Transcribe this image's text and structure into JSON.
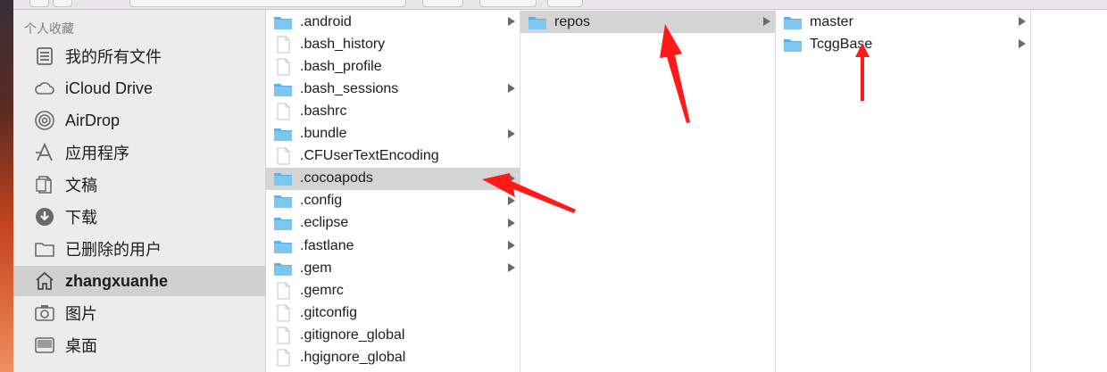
{
  "sidebar": {
    "header": "个人收藏",
    "items": [
      {
        "label": "我的所有文件",
        "icon": "all-files-icon"
      },
      {
        "label": "iCloud Drive",
        "icon": "cloud-icon"
      },
      {
        "label": "AirDrop",
        "icon": "airdrop-icon"
      },
      {
        "label": "应用程序",
        "icon": "applications-icon"
      },
      {
        "label": "文稿",
        "icon": "documents-icon"
      },
      {
        "label": "下载",
        "icon": "downloads-icon"
      },
      {
        "label": "已删除的用户",
        "icon": "folder-icon"
      },
      {
        "label": "zhangxuanhe",
        "icon": "home-icon",
        "selected": true
      },
      {
        "label": "图片",
        "icon": "pictures-icon"
      },
      {
        "label": "桌面",
        "icon": "desktop-icon"
      }
    ]
  },
  "column1": {
    "items": [
      {
        "name": ".android",
        "type": "folder",
        "expandable": true
      },
      {
        "name": ".bash_history",
        "type": "file"
      },
      {
        "name": ".bash_profile",
        "type": "file"
      },
      {
        "name": ".bash_sessions",
        "type": "folder",
        "expandable": true
      },
      {
        "name": ".bashrc",
        "type": "file"
      },
      {
        "name": ".bundle",
        "type": "folder",
        "expandable": true
      },
      {
        "name": ".CFUserTextEncoding",
        "type": "file"
      },
      {
        "name": ".cocoapods",
        "type": "folder",
        "expandable": true,
        "selected": true
      },
      {
        "name": ".config",
        "type": "folder",
        "expandable": true
      },
      {
        "name": ".eclipse",
        "type": "folder",
        "expandable": true
      },
      {
        "name": ".fastlane",
        "type": "folder",
        "expandable": true
      },
      {
        "name": ".gem",
        "type": "folder",
        "expandable": true
      },
      {
        "name": ".gemrc",
        "type": "file"
      },
      {
        "name": ".gitconfig",
        "type": "file"
      },
      {
        "name": ".gitignore_global",
        "type": "file"
      },
      {
        "name": ".hgignore_global",
        "type": "file"
      }
    ]
  },
  "column2": {
    "items": [
      {
        "name": "repos",
        "type": "folder",
        "expandable": true,
        "selected": true
      }
    ]
  },
  "column3": {
    "items": [
      {
        "name": "master",
        "type": "folder",
        "expandable": true
      },
      {
        "name": "TcggBase",
        "type": "folder",
        "expandable": true
      }
    ]
  },
  "colors": {
    "sidebar_bg": "#ececec",
    "selection_bg": "#d4d4d4",
    "folder_blue": "#5ab4e8",
    "arrow_red": "#ff1a1a"
  }
}
